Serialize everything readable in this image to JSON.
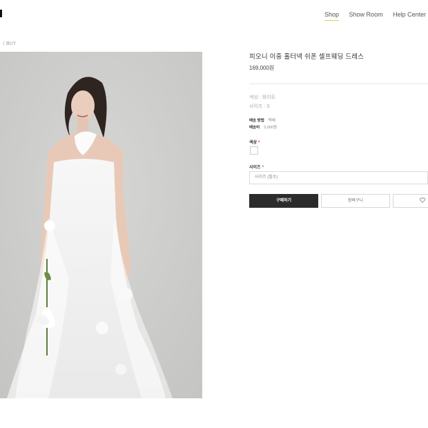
{
  "header": {
    "nav": [
      {
        "label": "Shop",
        "active": true
      },
      {
        "label": "Show Room",
        "active": false
      },
      {
        "label": "Help Center",
        "active": false
      }
    ]
  },
  "breadcrumb": {
    "text": "〈 BUY"
  },
  "product": {
    "title": "피오니 이중 홀터넥 쉬폰 셀프웨딩 드레스",
    "price": "169,000원",
    "selected_options": {
      "color": "색상 : 화이트",
      "size": "사이즈 : S"
    },
    "shipping": {
      "method_label": "배송 방법",
      "method_value": "택배",
      "fee_label": "배송비",
      "fee_value": "3,000원"
    },
    "color_option": {
      "label": "색상",
      "required_mark": "*"
    },
    "size_option": {
      "label": "사이즈",
      "required_mark": "*",
      "selected_value": "사이즈 (필수)"
    }
  },
  "actions": {
    "buy_label": "구매하기",
    "cart_label": "장바구니",
    "wish_icon": "heart-icon"
  },
  "colors": {
    "nav_underline": "#e1cf55",
    "buy_button_bg": "#2b2b2b",
    "required_mark": "#dd3333"
  }
}
